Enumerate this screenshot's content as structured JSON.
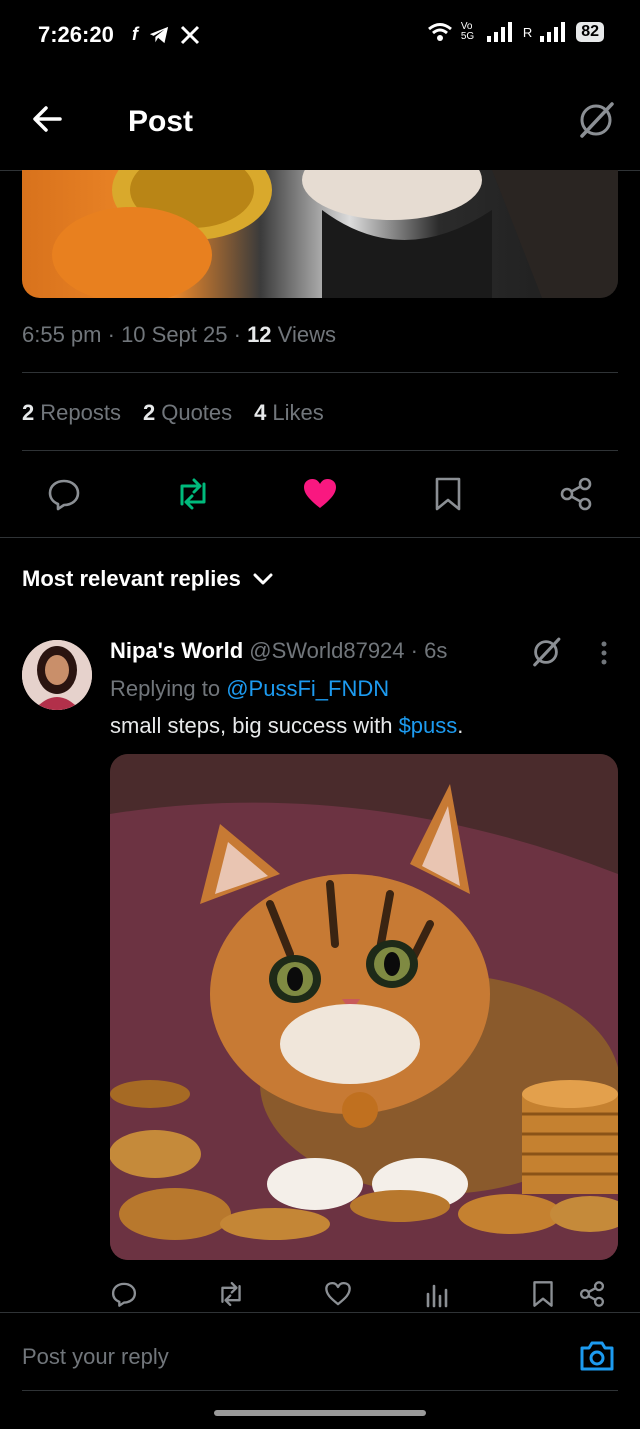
{
  "status_bar": {
    "time": "7:26:20",
    "battery": "82",
    "net_label": "Vo 5G",
    "sim2_label": "R"
  },
  "header": {
    "title": "Post"
  },
  "post": {
    "time": "6:55 pm",
    "date": "10 Sept 25",
    "views_count": "12",
    "views_label": "Views",
    "reposts_count": "2",
    "reposts_label": "Reposts",
    "quotes_count": "2",
    "quotes_label": "Quotes",
    "likes_count": "4",
    "likes_label": "Likes"
  },
  "colors": {
    "repost_green": "#00ba7c",
    "like_pink": "#f91880",
    "link_blue": "#1d9bf0"
  },
  "replies": {
    "sort_label": "Most relevant replies",
    "items": [
      {
        "name": "Nipa's World",
        "handle": "@SWorld87924",
        "age": "6s",
        "replying_label": "Replying to",
        "replying_to": "@PussFi_FNDN",
        "text_before": "small steps, big success with",
        "cashtag": "$puss",
        "text_after": "."
      }
    ]
  },
  "composer": {
    "placeholder": "Post your reply"
  }
}
